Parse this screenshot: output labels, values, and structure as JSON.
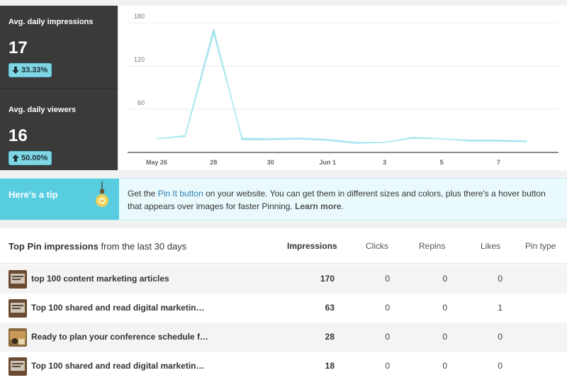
{
  "stats": [
    {
      "label": "Avg. daily impressions",
      "value": "17",
      "change": "33.33%",
      "direction": "down"
    },
    {
      "label": "Avg. daily viewers",
      "value": "16",
      "change": "50.00%",
      "direction": "up"
    }
  ],
  "chart_data": {
    "type": "line",
    "y_ticks": [
      "180",
      "120",
      "60"
    ],
    "ylim": [
      0,
      180
    ],
    "x_tick_labels": [
      "May 26",
      "28",
      "30",
      "Jun 1",
      "3",
      "5",
      "7"
    ],
    "x": [
      0,
      1,
      2,
      3,
      4,
      5,
      6,
      7,
      8,
      9,
      10,
      11,
      12,
      13
    ],
    "series": [
      {
        "values": [
          19,
          23,
          170,
          18,
          18,
          19,
          17,
          13,
          14,
          20,
          19,
          16,
          16,
          15
        ]
      },
      {
        "values": [
          19,
          22,
          165,
          20,
          19,
          20,
          18,
          14,
          14,
          21,
          19,
          17,
          17,
          16
        ]
      }
    ],
    "color": "#8fdcea"
  },
  "tip": {
    "title": "Here's a tip",
    "text_before": "Get the ",
    "link": "Pin It button",
    "text_after": " on your website. You can get them in different sizes and colors, plus there's a hover button that appears over images for faster Pinning. ",
    "learn_more": "Learn more",
    "end": "."
  },
  "table": {
    "title_bold": "Top Pin impressions",
    "title_rest": " from the last 30 days",
    "columns": {
      "impressions": "Impressions",
      "clicks": "Clicks",
      "repins": "Repins",
      "likes": "Likes",
      "pin_type": "Pin type"
    },
    "rows": [
      {
        "title": "top 100 content marketing articles",
        "impressions": "170",
        "clicks": "0",
        "repins": "0",
        "likes": "0",
        "thumb": "dark"
      },
      {
        "title": "Top 100 shared and read digital marketin…",
        "impressions": "63",
        "clicks": "0",
        "repins": "0",
        "likes": "1",
        "thumb": "dark"
      },
      {
        "title": "Ready to plan your conference schedule f…",
        "impressions": "28",
        "clicks": "0",
        "repins": "0",
        "likes": "0",
        "thumb": "warm"
      },
      {
        "title": "Top 100 shared and read digital marketin…",
        "impressions": "18",
        "clicks": "0",
        "repins": "0",
        "likes": "0",
        "thumb": "dark"
      }
    ]
  }
}
